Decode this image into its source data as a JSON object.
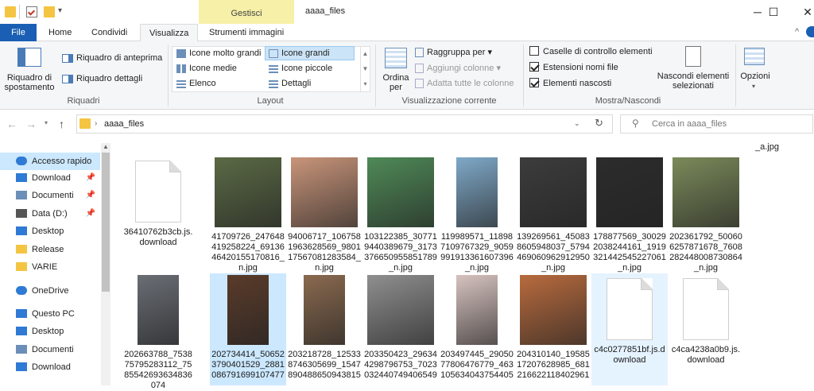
{
  "title_bar": {
    "context_tab": "Gestisci",
    "window_title": "aaaa_files",
    "minimize": "─",
    "maximize": "☐",
    "close": "✕"
  },
  "tabs": [
    "File",
    "Home",
    "Condividi",
    "Visualizza",
    "Strumenti immagini"
  ],
  "ribbon": {
    "riquadri": {
      "label": "Riquadri",
      "spostamento": "Riquadro di spostamento",
      "anteprima": "Riquadro di anteprima",
      "dettagli": "Riquadro dettagli"
    },
    "layout": {
      "label": "Layout",
      "options": [
        "Icone molto grandi",
        "Icone grandi",
        "Icone medie",
        "Icone piccole",
        "Elenco",
        "Dettagli"
      ],
      "selected": "Icone grandi"
    },
    "vista_corrente": {
      "label": "Visualizzazione corrente",
      "ordina": "Ordina per",
      "raggruppa": "Raggruppa per",
      "aggiungi": "Aggiungi colonne",
      "adatta": "Adatta tutte le colonne"
    },
    "mostra": {
      "label": "Mostra/Nascondi",
      "caselle": "Caselle di controllo elementi",
      "estensioni": "Estensioni nomi file",
      "nascosti": "Elementi nascosti",
      "nascondi": "Nascondi elementi selezionati",
      "checks": {
        "caselle": false,
        "estensioni": true,
        "nascosti": true
      }
    },
    "opzioni": "Opzioni"
  },
  "address": {
    "path": "aaaa_files",
    "search_placeholder": "Cerca in aaaa_files"
  },
  "nav_pane": [
    {
      "label": "Accesso rapido",
      "icon": "star-icon",
      "color": "#2f7ad4",
      "selected": true,
      "pinned": false
    },
    {
      "label": "Download",
      "icon": "download-icon",
      "color": "#2f7ad4",
      "selected": false,
      "pinned": true
    },
    {
      "label": "Documenti",
      "icon": "document-icon",
      "color": "#6b8fb8",
      "selected": false,
      "pinned": true
    },
    {
      "label": "Data (D:)",
      "icon": "drive-icon",
      "color": "#555555",
      "selected": false,
      "pinned": true
    },
    {
      "label": "Desktop",
      "icon": "desktop-icon",
      "color": "#2f7ad4",
      "selected": false,
      "pinned": false
    },
    {
      "label": "Release",
      "icon": "folder-icon",
      "color": "#f4c542",
      "selected": false,
      "pinned": false
    },
    {
      "label": "VARIE",
      "icon": "folder-icon",
      "color": "#f4c542",
      "selected": false,
      "pinned": false
    },
    {
      "label": "OneDrive",
      "icon": "cloud-icon",
      "color": "#2f7ad4",
      "selected": false,
      "pinned": false
    },
    {
      "label": "Questo PC",
      "icon": "pc-icon",
      "color": "#2f7ad4",
      "selected": false,
      "pinned": false
    },
    {
      "label": "Desktop",
      "icon": "desktop-icon",
      "color": "#2f7ad4",
      "selected": false,
      "pinned": false
    },
    {
      "label": "Documenti",
      "icon": "document-icon",
      "color": "#6b8fb8",
      "selected": false,
      "pinned": false
    },
    {
      "label": "Download",
      "icon": "download-icon",
      "color": "#2f7ad4",
      "selected": false,
      "pinned": false
    }
  ],
  "partial_top_label": "_a.jpg",
  "files": [
    {
      "name": "36410762b3cb.js.download",
      "kind": "doc",
      "color": ""
    },
    {
      "name": "41709726_247648419258224_6913646420155170816_n.jpg",
      "kind": "image",
      "color": "#5b6a45"
    },
    {
      "name": "94006717_1067581963628569_980117567081283584_n.jpg",
      "kind": "image",
      "color": "#c9957a"
    },
    {
      "name": "103122385_307719440389679_3173376650955851789_n.jpg",
      "kind": "image",
      "color": "#4f8a57"
    },
    {
      "name": "119989571_118987109767329_9059991913361607396_n.jpg",
      "kind": "image",
      "color": "#7fa9c8"
    },
    {
      "name": "139269561_450838605948037_5794469060962912950_n.jpg",
      "kind": "image",
      "color": "#3c3c3c"
    },
    {
      "name": "178877569_300292038244161_1919321442545227061_n.jpg",
      "kind": "image",
      "color": "#2c2c2c"
    },
    {
      "name": "202361792_500606257871678_7608282448008730864_n.jpg",
      "kind": "image",
      "color": "#7b8a5a"
    },
    {
      "name": "202663788_753875795283112_7585542693634836074",
      "kind": "image",
      "color": "#6a6e75"
    },
    {
      "name": "202734414_506523790401529_2881086791699107477",
      "kind": "image",
      "color": "#5a3b2a"
    },
    {
      "name": "203218728_125338746305699_1547890488650943815",
      "kind": "image",
      "color": "#8a6a4f"
    },
    {
      "name": "203350423_296344298796753_7023032440749406549",
      "kind": "image",
      "color": "#8f8f8f"
    },
    {
      "name": "203497445_2905077806476779_463105634043754405",
      "kind": "image",
      "color": "#d7c3c0"
    },
    {
      "name": "204310140_1958517207628985_681216622118402961",
      "kind": "image",
      "color": "#b86b3e"
    },
    {
      "name": "c4c0277851bf.js.download",
      "kind": "doc",
      "color": ""
    },
    {
      "name": "c4ca4238a0b9.js.download",
      "kind": "doc",
      "color": ""
    }
  ]
}
